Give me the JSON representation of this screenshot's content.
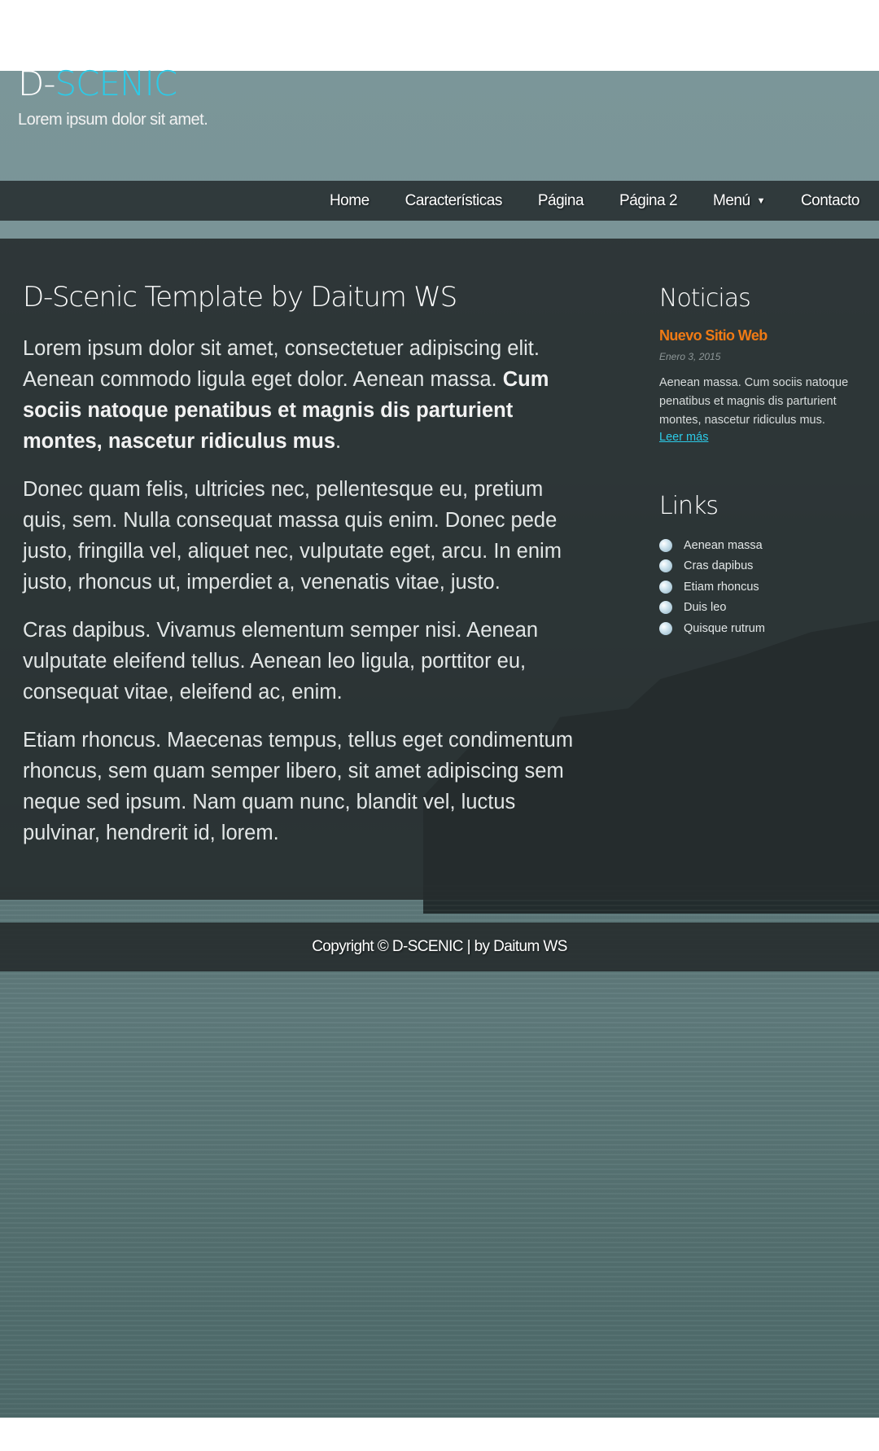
{
  "header": {
    "brand_prefix": "D-",
    "brand_accent": "SCENIC",
    "tagline": "Lorem ipsum dolor sit amet."
  },
  "nav": {
    "items": [
      "Home",
      "Características",
      "Página",
      "Página 2",
      "Menú",
      "Contacto"
    ],
    "dropdown_icon": "caret-down-icon"
  },
  "main": {
    "title": "D-Scenic Template by Daitum WS",
    "p1_text": "Lorem ipsum dolor sit amet, consectetuer adipiscing elit. Aenean commodo ligula eget dolor. Aenean massa. ",
    "p1_bold": "Cum sociis natoque penatibus et magnis dis parturient montes, nascetur ridiculus mus",
    "p1_end": ".",
    "p2": "Donec quam felis, ultricies nec, pellentesque eu, pretium quis, sem. Nulla consequat massa quis enim. Donec pede justo, fringilla vel, aliquet nec, vulputate eget, arcu. In enim justo, rhoncus ut, imperdiet a, venenatis vitae, justo.",
    "p3": "Cras dapibus. Vivamus elementum semper nisi. Aenean vulputate eleifend tellus. Aenean leo ligula, porttitor eu, consequat vitae, eleifend ac, enim.",
    "p4": "Etiam rhoncus. Maecenas tempus, tellus eget condimentum rhoncus, sem quam semper libero, sit amet adipiscing sem neque sed ipsum. Nam quam nunc, blandit vel, luctus pulvinar, hendrerit id, lorem."
  },
  "sidebar": {
    "news_heading": "Noticias",
    "news_title": "Nuevo Sitio Web",
    "news_date": "Enero 3, 2015",
    "news_body": "Aenean massa. Cum sociis natoque penatibus et magnis dis parturient montes, nascetur ridiculus mus.",
    "news_more": "Leer más",
    "links_heading": "Links",
    "links": [
      "Aenean massa",
      "Cras dapibus",
      "Etiam rhoncus",
      "Duis leo",
      "Quisque rutrum"
    ]
  },
  "footer": {
    "text": "Copyright © D-SCENIC | by Daitum WS"
  },
  "colors": {
    "accent": "#2ccbe8",
    "news_title": "#f07a14",
    "panel": "#262c2e"
  }
}
